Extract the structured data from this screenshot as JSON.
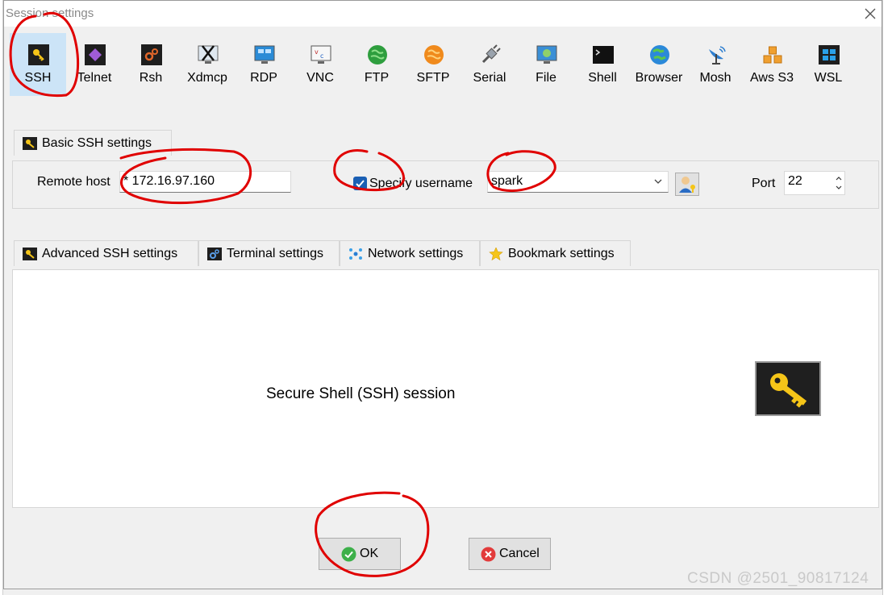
{
  "window": {
    "title": "Session settings"
  },
  "protocols": [
    {
      "label": "SSH",
      "icon": "key-icon",
      "selected": true
    },
    {
      "label": "Telnet",
      "icon": "telnet-icon"
    },
    {
      "label": "Rsh",
      "icon": "rsh-icon"
    },
    {
      "label": "Xdmcp",
      "icon": "xdmcp-icon"
    },
    {
      "label": "RDP",
      "icon": "rdp-monitor-icon"
    },
    {
      "label": "VNC",
      "icon": "vnc-icon"
    },
    {
      "label": "FTP",
      "icon": "ftp-globe-icon"
    },
    {
      "label": "SFTP",
      "icon": "sftp-globe-icon"
    },
    {
      "label": "Serial",
      "icon": "serial-plug-icon"
    },
    {
      "label": "File",
      "icon": "file-monitor-icon"
    },
    {
      "label": "Shell",
      "icon": "terminal-icon"
    },
    {
      "label": "Browser",
      "icon": "browser-globe-icon"
    },
    {
      "label": "Mosh",
      "icon": "satellite-icon"
    },
    {
      "label": "Aws S3",
      "icon": "aws-cubes-icon"
    },
    {
      "label": "WSL",
      "icon": "windows-icon"
    }
  ],
  "basic": {
    "tab_label": "Basic SSH settings",
    "remote_host_label": "Remote host",
    "remote_host_value": "* 172.16.97.160",
    "specify_username_label": "Specify username",
    "specify_username_checked": true,
    "username_value": "spark",
    "port_label": "Port",
    "port_value": "22"
  },
  "advanced_tabs": [
    {
      "label": "Advanced SSH settings",
      "icon": "key-icon"
    },
    {
      "label": "Terminal settings",
      "icon": "terminal-gear-icon"
    },
    {
      "label": "Network settings",
      "icon": "network-icon"
    },
    {
      "label": "Bookmark settings",
      "icon": "star-icon"
    }
  ],
  "content": {
    "description": "Secure Shell (SSH) session"
  },
  "buttons": {
    "ok_label": "OK",
    "cancel_label": "Cancel"
  },
  "watermark": "CSDN @2501_90817124",
  "colors": {
    "selected_bg": "#cce4f7",
    "checkbox": "#1a5fb4",
    "annotation": "#e00000"
  }
}
